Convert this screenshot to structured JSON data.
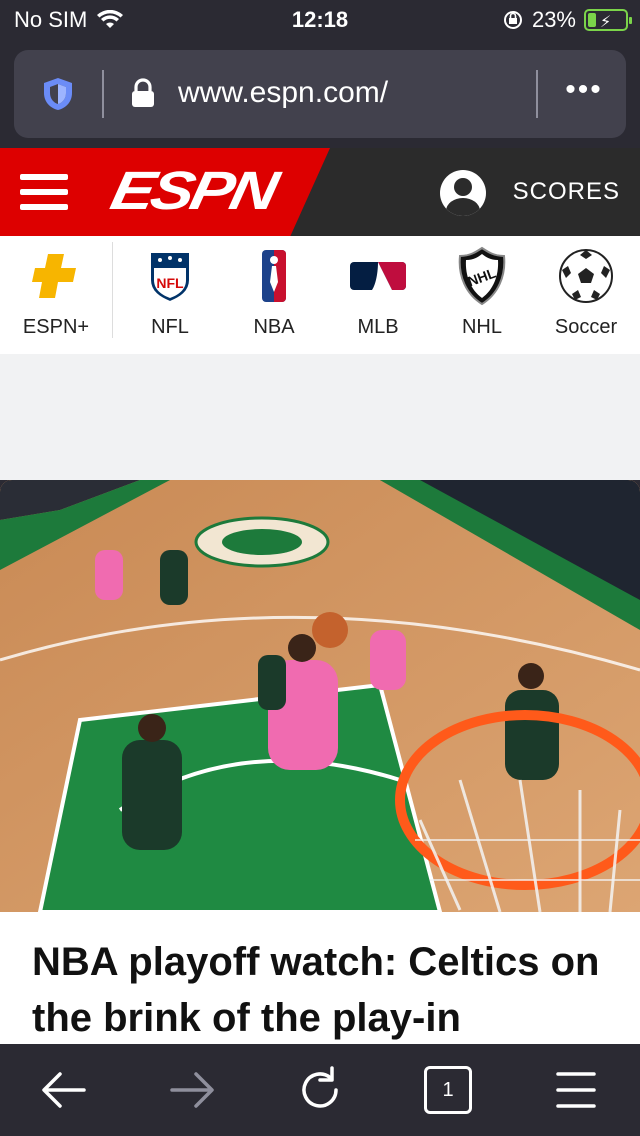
{
  "status_bar": {
    "carrier": "No SIM",
    "time": "12:18",
    "battery_percent": "23%",
    "battery_level": 0.23
  },
  "browser": {
    "url": "www.espn.com/",
    "more_label": "•••",
    "tab_count": "1"
  },
  "espn_header": {
    "logo_text": "ESPN",
    "scores_label": "SCORES"
  },
  "sports": [
    {
      "label": "ESPN+"
    },
    {
      "label": "NFL"
    },
    {
      "label": "NBA"
    },
    {
      "label": "MLB"
    },
    {
      "label": "NHL"
    },
    {
      "label": "Soccer"
    }
  ],
  "article": {
    "headline": "NBA playoff watch: Celtics on the brink of the play-in"
  },
  "colors": {
    "espn_red": "#dd0000",
    "espn_plus_yellow": "#f7b500",
    "browser_bg": "#2b2a33"
  }
}
